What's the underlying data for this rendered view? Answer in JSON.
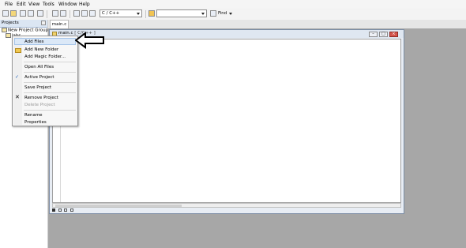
{
  "menubar": {
    "items": [
      "File",
      "Edit",
      "View",
      "Tools",
      "Window",
      "Help"
    ]
  },
  "toolbar": {
    "language_combo": "C / C++",
    "search_combo": "",
    "find_label": "Find"
  },
  "tabs": {
    "active": "main.c"
  },
  "projects_panel": {
    "title": "Projects",
    "tree_root": "New Project Group",
    "tree_child": "labs"
  },
  "editor": {
    "title": "main.c",
    "title_suffix": "[ C/C++ ]"
  },
  "context_menu": {
    "items": [
      "Add Files",
      "Add New Folder",
      "Add Magic Folder...",
      "Open All Files",
      "Active Project",
      "Save Project",
      "Remove Project",
      "Delete Project",
      "Rename",
      "Properties"
    ]
  },
  "icons": {
    "arrow": "arrow-left-icon",
    "check": "checkmark-icon",
    "remove": "x-icon",
    "folder": "folder-icon"
  },
  "colors": {
    "workspace": "#a7a7a7",
    "menu_highlight": "#dbe8f7",
    "close_button": "#d4554d"
  }
}
